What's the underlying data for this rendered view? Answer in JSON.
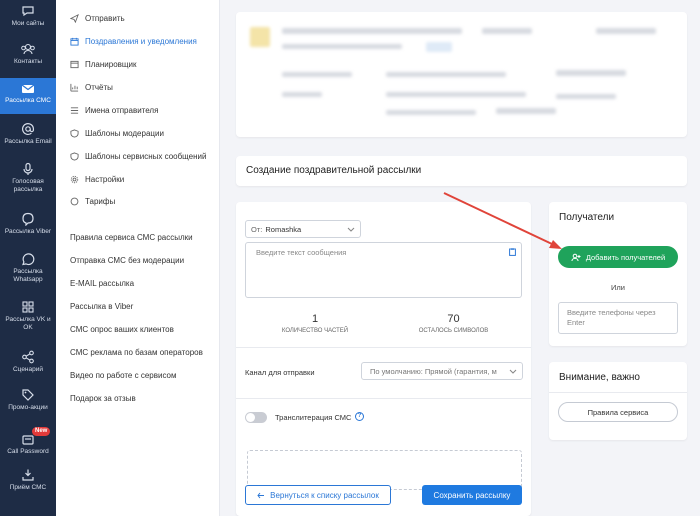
{
  "nav": [
    {
      "label": "Мои сайты",
      "icon": "chat-icon"
    },
    {
      "label": "Контакты",
      "icon": "contacts-icon"
    },
    {
      "label": "Рассылка СМС",
      "icon": "envelope-icon",
      "active": true
    },
    {
      "label": "Рассылка Email",
      "icon": "at-icon"
    },
    {
      "label": "Голосовая рассылка",
      "icon": "microphone-icon"
    },
    {
      "label": "Рассылка Viber",
      "icon": "viber-icon"
    },
    {
      "label": "Рассылка Whatsapp",
      "icon": "whatsapp-icon"
    },
    {
      "label": "Рассылка VK и OK",
      "icon": "vk-icon"
    },
    {
      "label": "Сценарий",
      "icon": "share-icon"
    },
    {
      "label": "Промо-акции",
      "icon": "tag-icon"
    },
    {
      "label": "Call Password",
      "icon": "phone-icon",
      "badge": "New"
    },
    {
      "label": "Приём СМС",
      "icon": "inbox-icon"
    }
  ],
  "menu": {
    "items": [
      {
        "label": "Отправить",
        "icon": "send-icon"
      },
      {
        "label": "Поздравления и уведомления",
        "icon": "calendar-icon",
        "active": true
      },
      {
        "label": "Планировщик",
        "icon": "scheduler-icon"
      },
      {
        "label": "Отчёты",
        "icon": "chart-icon"
      },
      {
        "label": "Имена отправителя",
        "icon": "list-icon"
      },
      {
        "label": "Шаблоны модерации",
        "icon": "shield-icon"
      },
      {
        "label": "Шаблоны сервисных сообщений",
        "icon": "shield-icon"
      },
      {
        "label": "Настройки",
        "icon": "gear-icon"
      },
      {
        "label": "Тарифы",
        "icon": "coin-icon"
      }
    ],
    "links": [
      "Правила сервиса СМС рассылки",
      "Отправка СМС без модерации",
      "E-MAIL рассылка",
      "Рассылка в Viber",
      "СМС опрос ваших клиентов",
      "СМС реклама по базам операторов",
      "Видео по работе с сервисом",
      "Подарок за отзыв"
    ]
  },
  "page": {
    "title": "Создание поздравительной рассылки"
  },
  "form": {
    "sender_label": "От:",
    "sender_value": "Romashka",
    "message_placeholder": "Введите текст сообщения",
    "parts_count": "1",
    "parts_label": "КОЛИЧЕСТВО ЧАСТЕЙ",
    "chars_left": "70",
    "chars_label": "ОСТАЛОСЬ СИМВОЛОВ",
    "channel_label": "Канал для отправки",
    "channel_value": "По умолчанию: Прямой (гарантия, м",
    "translit_label": "Транслитерация СМС",
    "back_button": "Вернуться к списку рассылок",
    "save_button": "Сохранить рассылку"
  },
  "recipients": {
    "title": "Получатели",
    "add_button": "Добавить получателей",
    "or_label": "Или",
    "phones_placeholder": "Введите телефоны через Enter"
  },
  "attention": {
    "title": "Внимание, важно",
    "rules_button": "Правила сервиса"
  },
  "colors": {
    "sidebar": "#1e2c45",
    "accent": "#2b77d6",
    "green": "#1fa35b",
    "arrow": "#e0443a"
  }
}
